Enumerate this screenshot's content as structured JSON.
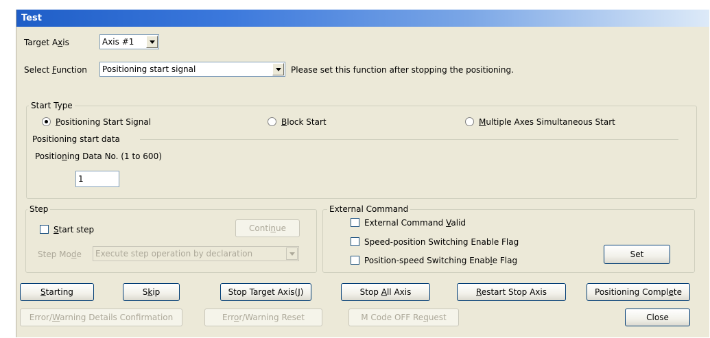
{
  "window": {
    "title": "Test"
  },
  "target_axis": {
    "label_pre": "Target A",
    "label_ul": "x",
    "label_post": "is",
    "value": "Axis #1"
  },
  "select_function": {
    "label_pre": "Select ",
    "label_ul": "F",
    "label_post": "unction",
    "value": "Positioning start signal",
    "note": "Please set this function after stopping the positioning."
  },
  "start_type": {
    "title": "Start Type",
    "options": [
      {
        "ul": "P",
        "rest": "ositioning Start Signal",
        "selected": true
      },
      {
        "ul": "B",
        "rest": "lock Start",
        "selected": false
      },
      {
        "ul": "M",
        "rest": "ultiple Axes Simultaneous Start",
        "selected": false
      }
    ],
    "data_heading": "Positioning start data",
    "data_no_label_pre": "Positio",
    "data_no_label_ul": "n",
    "data_no_label_post": "ing Data No. (1 to 600)",
    "data_no_value": "1"
  },
  "step": {
    "title": "Step",
    "start_step_ul": "S",
    "start_step_rest": "tart step",
    "continue_pre": "Conti",
    "continue_ul": "n",
    "continue_post": "ue",
    "mode_label_pre": "Step Mo",
    "mode_label_ul": "d",
    "mode_label_post": "e",
    "mode_value": "Execute step operation by declaration"
  },
  "external_command": {
    "title": "External Command",
    "items": [
      {
        "pre": "External Command ",
        "ul": "V",
        "post": "alid"
      },
      {
        "pre": "Speed-position Switching Enable Flag",
        "ul": "",
        "post": ""
      },
      {
        "pre": "Position-speed Switching Enab",
        "ul": "l",
        "post": "e Flag"
      }
    ],
    "set_label": "Set"
  },
  "buttons": {
    "starting": {
      "ul": "S",
      "rest": "tarting"
    },
    "skip": {
      "pre": "S",
      "ul": "k",
      "post": "ip"
    },
    "stop_target": {
      "pre": "Stop Target Axis(",
      "ul": "J",
      "post": ")"
    },
    "stop_all": {
      "pre": "Stop ",
      "ul": "A",
      "post": "ll Axis"
    },
    "restart": {
      "ul": "R",
      "rest": "estart Stop Axis"
    },
    "pos_complete": {
      "pre": "Positioning Compl",
      "ul": "e",
      "post": "te"
    },
    "error_details": {
      "pre": "Error/",
      "ul": "W",
      "post": "arning Details Confirmation"
    },
    "error_reset": {
      "pre": "Err",
      "ul": "o",
      "post": "r/Warning Reset"
    },
    "mcode_off": {
      "pre": "M Code OFF Re",
      "ul": "q",
      "post": "uest"
    },
    "close": "Close"
  }
}
